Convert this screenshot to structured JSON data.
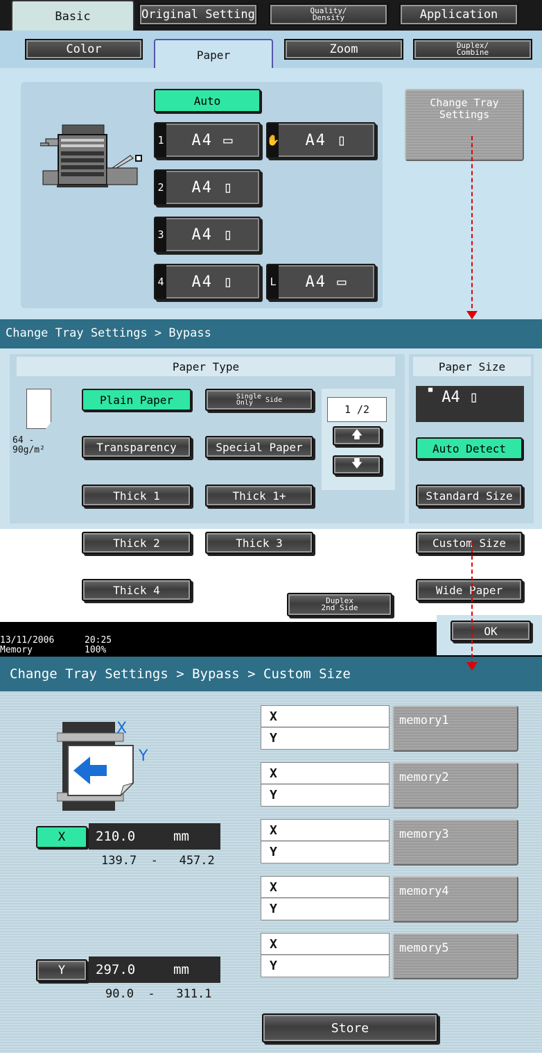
{
  "tabs": {
    "basic": "Basic",
    "original_setting": "Original Setting",
    "quality_density": [
      "Quality/",
      "Density"
    ],
    "application": "Application"
  },
  "subtabs": {
    "color": "Color",
    "paper": "Paper",
    "zoom": "Zoom",
    "duplex_combine": [
      "Duplex/",
      "Combine"
    ]
  },
  "paper_panel": {
    "auto_label": "Auto",
    "trays": [
      {
        "id": "1",
        "size": "A4"
      },
      {
        "id": "bypass",
        "size": "A4"
      },
      {
        "id": "2",
        "size": "A4"
      },
      {
        "id": "3",
        "size": "A4"
      },
      {
        "id": "4",
        "size": "A4"
      },
      {
        "id": "L",
        "size": "A4"
      }
    ],
    "change_tray_label": [
      "Change Tray",
      "Settings"
    ]
  },
  "bypass": {
    "breadcrumb": "Change Tray Settings > Bypass",
    "paper_type_header": "Paper Type",
    "weight": [
      "64  -",
      "90g/m²"
    ],
    "types": [
      "Plain Paper",
      "Single Side Only",
      "Transparency",
      "Special Paper",
      "Thick 1",
      "Thick 1+",
      "Thick 2",
      "Thick 3",
      "Thick 4",
      "Duplex 2nd Side"
    ],
    "single_side": [
      "Single",
      "Side",
      "Only"
    ],
    "duplex_2nd": [
      "Duplex",
      "2nd Side"
    ],
    "page_indicator": "1 /2",
    "paper_size_header": "Paper Size",
    "current_size": "A4",
    "size_options": [
      "Auto Detect",
      "Standard Size",
      "Custom Size",
      "Wide Paper"
    ]
  },
  "status": {
    "date": "13/11/2006",
    "time": "20:25",
    "memory_label": "Memory",
    "memory_value": "100%",
    "ok_label": "OK"
  },
  "custom": {
    "breadcrumb": "Change Tray Settings > Bypass > Custom Size",
    "x_button": "X",
    "x_value": "210.0",
    "x_unit": "mm",
    "x_range": "139.7  -   457.2",
    "y_button": "Y",
    "y_value": "297.0",
    "y_unit": "mm",
    "y_range": "90.0  -   311.1",
    "axis_x": "X",
    "axis_y": "Y",
    "memories": [
      "memory1",
      "memory2",
      "memory3",
      "memory4",
      "memory5"
    ],
    "store_label": "Store"
  },
  "colors": {
    "accent_green": "#2fe6a4",
    "header_teal": "#2e6e86",
    "arrow_red": "#e00000"
  }
}
